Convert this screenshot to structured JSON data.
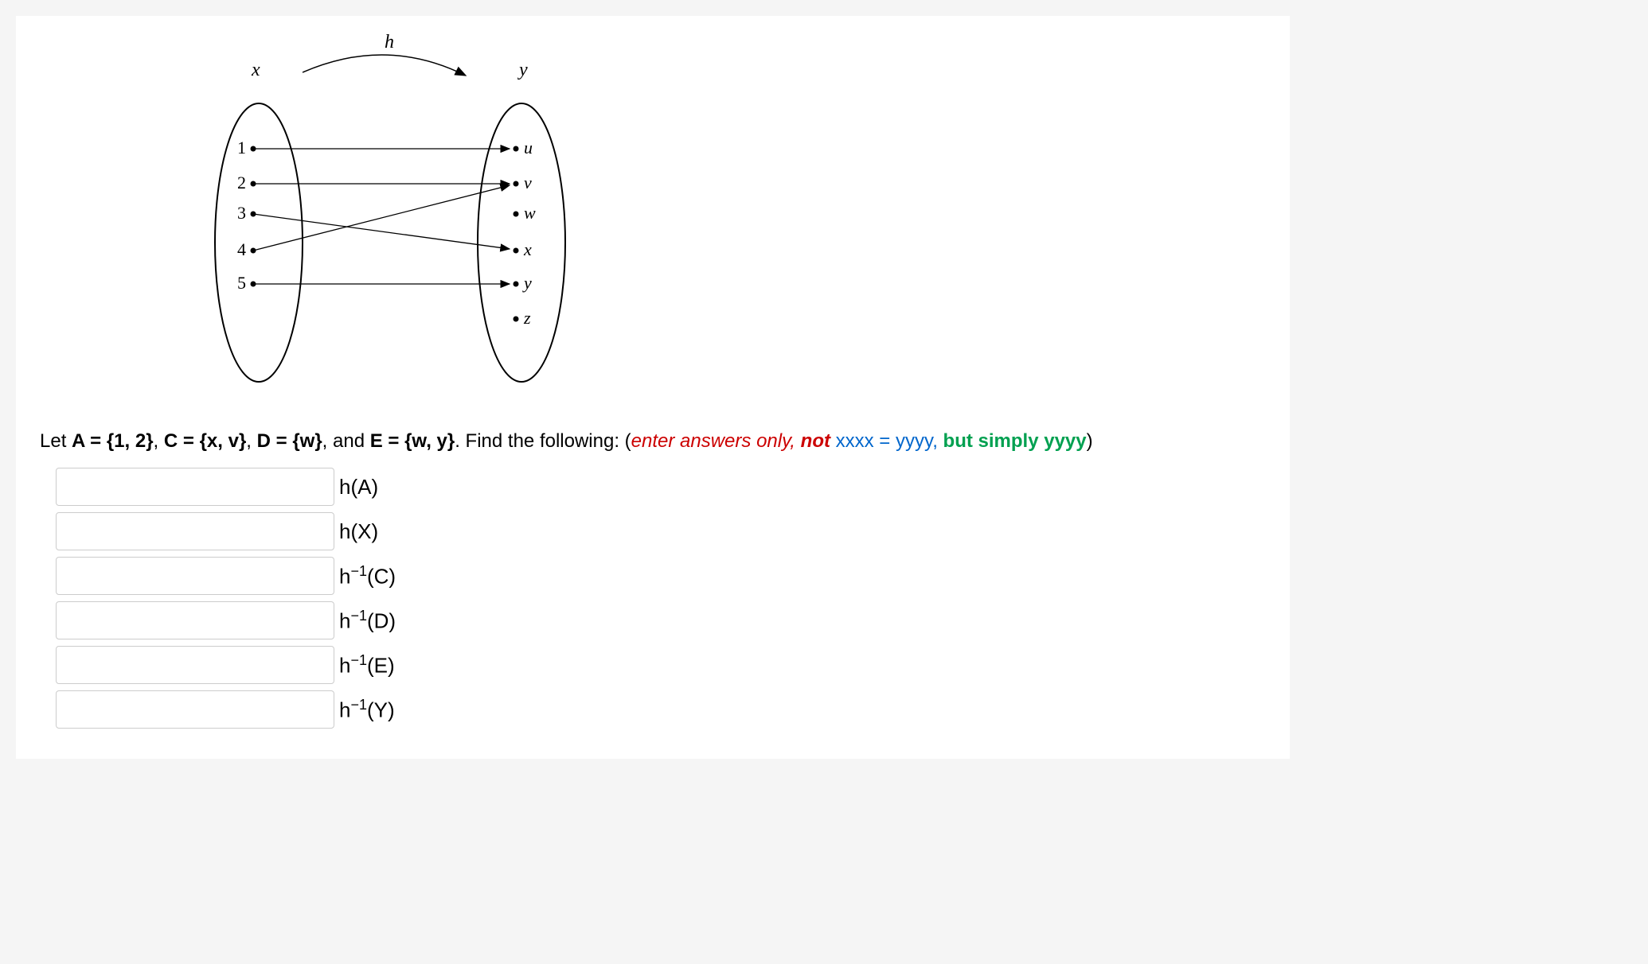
{
  "diagram": {
    "function_label": "h",
    "domain_label": "x",
    "codomain_label": "y",
    "domain_elements": [
      "1",
      "2",
      "3",
      "4",
      "5"
    ],
    "codomain_elements": [
      "u",
      "v",
      "w",
      "x",
      "y",
      "z"
    ],
    "mappings": [
      {
        "from": "1",
        "to": "u"
      },
      {
        "from": "2",
        "to": "v"
      },
      {
        "from": "3",
        "to": "x"
      },
      {
        "from": "4",
        "to": "v"
      },
      {
        "from": "5",
        "to": "y"
      }
    ]
  },
  "question": {
    "lead": "Let  ",
    "set_A": "A = {1, 2}",
    "sep1": ",   ",
    "set_C": "C = {x, v}",
    "sep2": ",   ",
    "set_D": "D = {w}",
    "sep3": ",  and  ",
    "set_E": "E = {w, y}",
    "trail": ". Find the following: (",
    "hint1": "enter answers only, ",
    "hint_not": "not",
    "hint2_blue": " xxxx = yyyy, ",
    "hint3_green": "but simply yyyy",
    "close": ")"
  },
  "answers": [
    {
      "label": "h(A)"
    },
    {
      "label": "h(X)"
    },
    {
      "label_html": "h<sup>−1</sup>(C)"
    },
    {
      "label_html": "h<sup>−1</sup>(D)"
    },
    {
      "label_html": "h<sup>−1</sup>(E)"
    },
    {
      "label_html": "h<sup>−1</sup>(Y)"
    }
  ]
}
